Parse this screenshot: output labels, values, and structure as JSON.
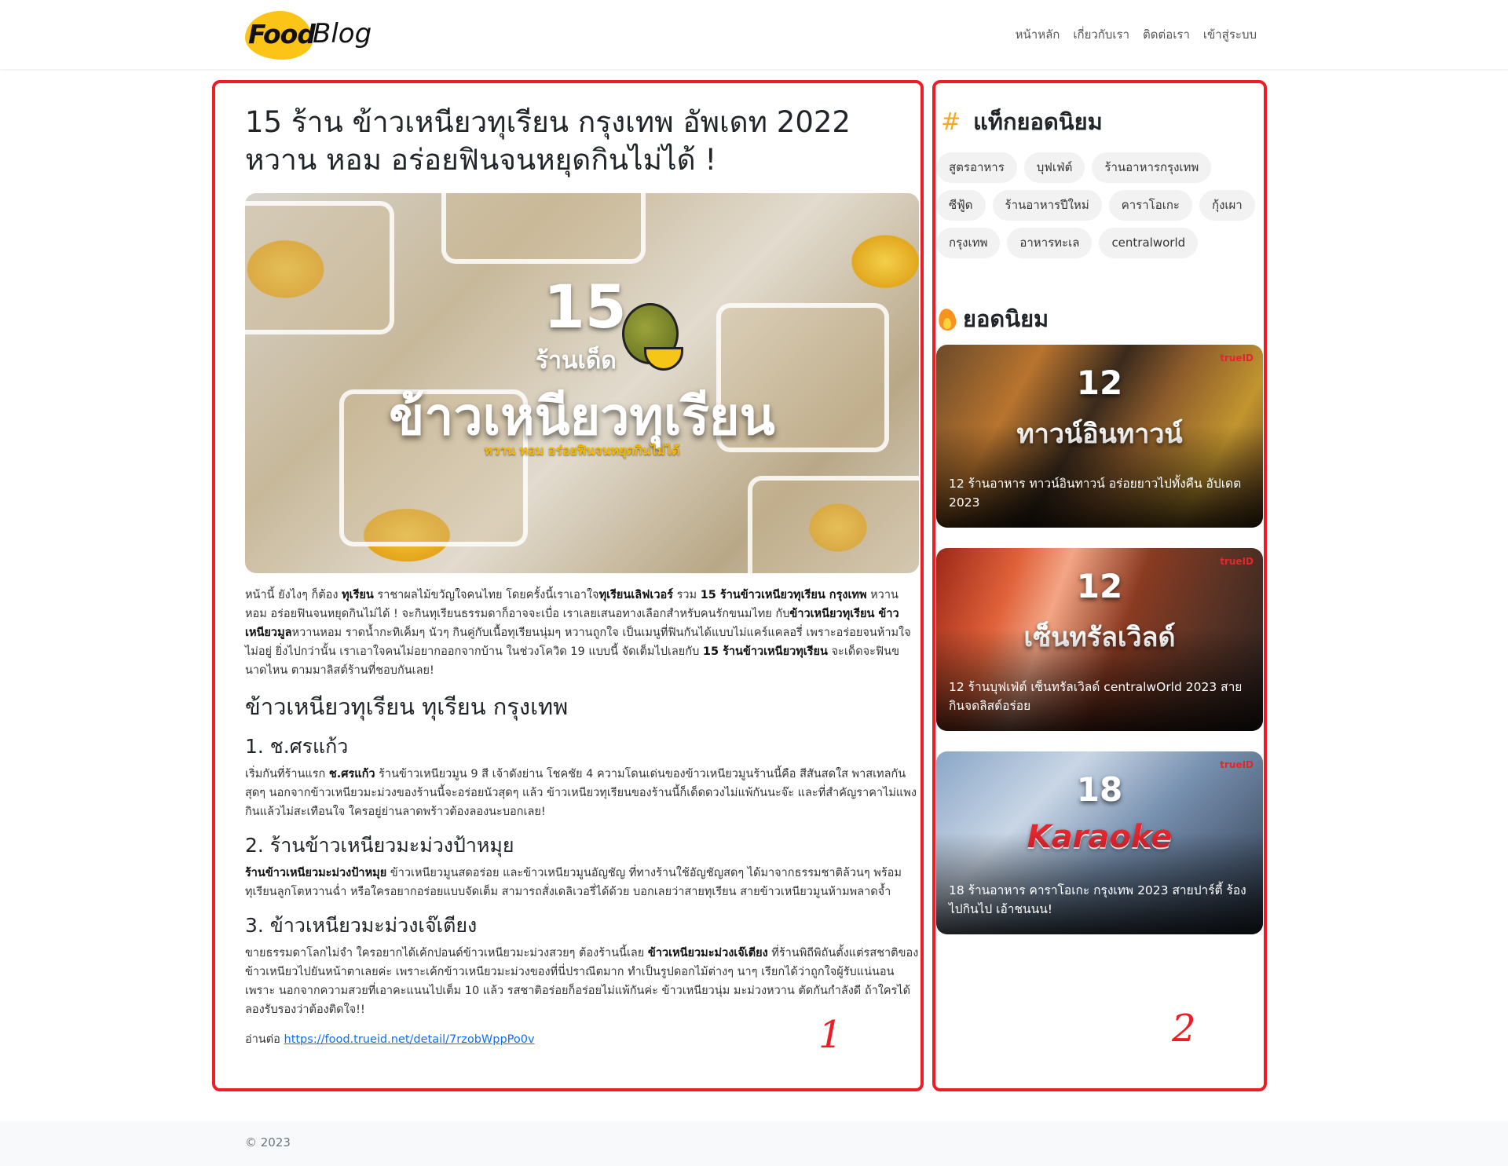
{
  "nav": {
    "logo_food": "Food",
    "logo_blog": "Blog",
    "links": [
      "หน้าหลัก",
      "เกี่ยวกับเรา",
      "ติดต่อเรา",
      "เข้าสู่ระบบ"
    ]
  },
  "article": {
    "title": "15 ร้าน ข้าวเหนียวทุเรียน กรุงเทพ อัพเดท 2022 หวาน หอม อร่อยฟินจนหยุดกินไม่ได้ !",
    "hero": {
      "number": "15",
      "sub": "ร้านเด็ด",
      "title": "ข้าวเหนียวทุเรียน",
      "tagline": "หวาน หอม อร่อยฟินจนหยุดกินไม่ได้"
    },
    "intro_segments": [
      {
        "t": "หน้านี้ ยังไงๆ ก็ต้อง ",
        "b": false
      },
      {
        "t": "ทุเรียน",
        "b": true
      },
      {
        "t": " ราชาผลไม้ขวัญใจคนไทย โดยครั้งนี้เราเอาใจ",
        "b": false
      },
      {
        "t": "ทุเรียนเลิฟเวอร์",
        "b": true
      },
      {
        "t": " รวม ",
        "b": false
      },
      {
        "t": "15 ร้านข้าวเหนียวทุเรียน กรุงเทพ",
        "b": true
      },
      {
        "t": " หวาน หอม อร่อยฟินจนหยุดกินไม่ได้ ! จะกินทุเรียนธรรมดาก็อาจจะเบื่อ เราเลยเสนอทางเลือกสำหรับคนรักขนมไทย กับ",
        "b": false
      },
      {
        "t": "ข้าวเหนียวทุเรียน ข้าวเหนียวมูล",
        "b": true
      },
      {
        "t": "หวานหอม ราดน้ำกะทิเค็มๆ นัวๆ กินคู่กับเนื้อทุเรียนนุ่มๆ หวานถูกใจ เป็นเมนูที่ฟินกันได้แบบไม่แคร์แคลอรี่ เพราะอร่อยจนห้ามใจไม่อยู่ ยิ่งไปกว่านั้น เราเอาใจคนไม่อยากออกจากบ้าน ในช่วงโควิด 19 แบบนี้ จัดเต็มไปเลยกับ ",
        "b": false
      },
      {
        "t": "15 ร้านข้าวเหนียวทุเรียน",
        "b": true
      },
      {
        "t": " จะเด็ดจะฟินขนาดไหน ตามมาลิสต์ร้านที่ชอบกันเลย!",
        "b": false
      }
    ],
    "section_heading": "ข้าวเหนียวทุเรียน ทุเรียน กรุงเทพ",
    "sections": [
      {
        "heading": "1. ช.ศรแก้ว",
        "segments": [
          {
            "t": "เริ่มกันที่ร้านแรก ",
            "b": false
          },
          {
            "t": "ช.ศรแก้ว",
            "b": true
          },
          {
            "t": " ร้านข้าวเหนียวมูน 9 สี เจ้าดังย่าน โชคชัย 4 ความโดนเด่นของข้าวเหนียวมูนร้านนี้คือ สีสันสดใส พาสเทลกันสุดๆ นอกจากข้าวเหนียวมะม่วงของร้านนี้จะอร่อยนัวสุดๆ แล้ว ข้าวเหนียวทุเรียนของร้านนี้ก็เด็ดดวงไม่แพ้กันนะจ๊ะ และที่สำคัญราคาไม่แพง กินแล้วไม่สะเทือนใจ ใครอยู่ย่านลาดพร้าวต้องลองนะบอกเลย!",
            "b": false
          }
        ]
      },
      {
        "heading": "2. ร้านข้าวเหนียวมะม่วงป้าหมุย",
        "segments": [
          {
            "t": "ร้านข้าวเหนียวมะม่วงป้าหมุย",
            "b": true
          },
          {
            "t": " ข้าวเหนียวมูนสดอร่อย และข้าวเหนียวมูนอัญชัญ ที่ทางร้านใช้อัญชัญสดๆ ได้มาจากธรรมชาติล้วนๆ พร้อมทุเรียนลูกโตหวานฉ่ำ หรือใครอยากอร่อยแบบจัดเต็ม สามารถสั่งเดลิเวอรี่ได้ด้วย บอกเลยว่าสายทุเรียน สายข้าวเหนียวมูนห้ามพลาดจ้ำ",
            "b": false
          }
        ]
      },
      {
        "heading": "3. ข้าวเหนียวมะม่วงเจ๊เตียง",
        "segments": [
          {
            "t": "ขายธรรมดาโลกไม่จำ ใครอยากได้เค้กปอนด์ข้าวเหนียวมะม่วงสวยๆ ต้องร้านนี้เลย ",
            "b": false
          },
          {
            "t": "ข้าวเหนียวมะม่วงเจ๊เตียง",
            "b": true
          },
          {
            "t": " ที่ร้านพิถีพิถันตั้งแต่รสชาติของข้าวเหนียวไปยันหน้าตาเลยค่ะ เพราะเค้กข้าวเหนียวมะม่วงของที่นี่ปราณีตมาก ทำเป็นรูปดอกไม้ต่างๆ นาๆ เรียกได้ว่าถูกใจผู้รับแน่นอน เพราะ นอกจากความสวยที่เอาคะแนนไปเต็ม 10 แล้ว รสชาติอร่อยก็อร่อยไม่แพ้กันค่ะ ข้าวเหนียวนุ่ม มะม่วงหวาน ตัดกันกำลังดี ถ้าใครได้ลองรับรองว่าต้องติดใจ!!",
            "b": false
          }
        ]
      }
    ],
    "read_more_label": "อ่านต่อ",
    "read_more_url": "https://food.trueid.net/detail/7rzobWppPo0v"
  },
  "sidebar": {
    "tags_heading": "แท็กยอดนิยม",
    "tags": [
      "สูตรอาหาร",
      "บุฟเฟ่ต์",
      "ร้านอาหารกรุงเทพ",
      "ซีฟู้ด",
      "ร้านอาหารปีใหม่",
      "คาราโอเกะ",
      "กุ้งเผา",
      "กรุงเทพ",
      "อาหารทะเล",
      "centralworld"
    ],
    "popular_heading": "ยอดนิยม",
    "cards": [
      {
        "big": "12",
        "overlay": "ทาวน์อินทาวน์",
        "brand": "trueID",
        "title": "12 ร้านอาหาร ทาวน์อินทาวน์ อร่อยยาวไปทั้งคืน อัปเดต 2023"
      },
      {
        "big": "12",
        "overlay": "เซ็นทรัลเวิลด์",
        "brand": "trueID",
        "title": "12 ร้านบุฟเฟ่ต์ เซ็นทรัลเวิลด์ centralwOrld 2023 สายกินจดลิสต์อร่อย"
      },
      {
        "big": "18",
        "overlay": "Karaoke",
        "brand": "trueID",
        "title": "18 ร้านอาหาร คาราโอเกะ กรุงเทพ 2023 สายปาร์ตี้ ร้องไปกินไป เอ้าชนนน!"
      }
    ]
  },
  "annotations": [
    "1",
    "2"
  ],
  "footer": {
    "copyright": "© 2023"
  },
  "colors": {
    "annotation": "#ee1c25",
    "logo_accent": "#fbc417",
    "hash_accent": "#f7a823",
    "link": "#0d6efd"
  }
}
